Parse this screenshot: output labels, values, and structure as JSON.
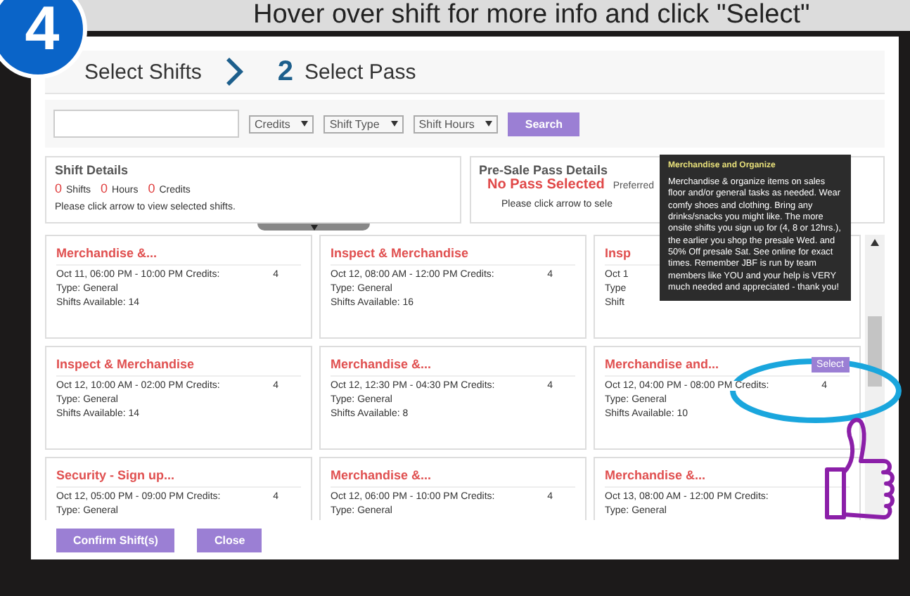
{
  "instruction": {
    "step": "4",
    "text": "Hover over shift for more info and click \"Select\""
  },
  "steps": [
    {
      "label": "Select Shifts"
    },
    {
      "number": "2",
      "label": "Select Pass"
    }
  ],
  "filters": {
    "dropdowns": [
      "Credits",
      "Shift Type",
      "Shift Hours"
    ],
    "search_button": "Search"
  },
  "shift_details": {
    "title": "Shift Details",
    "counts": [
      {
        "value": "0",
        "unit": "Shifts"
      },
      {
        "value": "0",
        "unit": "Hours"
      },
      {
        "value": "0",
        "unit": "Credits"
      }
    ],
    "hint": "Please click arrow to view selected shifts."
  },
  "pass_details": {
    "title": "Pre-Sale Pass Details",
    "status": "No Pass Selected",
    "preferred": "Preferred",
    "hint": "Please click arrow to sele"
  },
  "shifts": [
    {
      "title": "Merchandise &...",
      "time": "Oct 11, 06:00 PM - 10:00 PM Credits:",
      "credits": "4",
      "type": "Type: General",
      "available": "Shifts Available: 14",
      "hovered": false
    },
    {
      "title": "Inspect & Merchandise",
      "time": "Oct 12, 08:00 AM - 12:00 PM Credits:",
      "credits": "4",
      "type": "Type: General",
      "available": "Shifts Available: 16",
      "hovered": false
    },
    {
      "title": "Insp",
      "time": "Oct 1",
      "type": "Type",
      "available": "Shift",
      "hovered": false
    },
    {
      "title": "Inspect & Merchandise",
      "time": "Oct 12, 10:00 AM - 02:00 PM Credits:",
      "credits": "4",
      "type": "Type: General",
      "available": "Shifts Available: 14",
      "hovered": false
    },
    {
      "title": "Merchandise &...",
      "time": "Oct 12, 12:30 PM - 04:30 PM Credits:",
      "credits": "4",
      "type": "Type: General",
      "available": "Shifts Available: 8",
      "hovered": false
    },
    {
      "title": "Merchandise and...",
      "time": "Oct 12, 04:00 PM - 08:00 PM Credits:",
      "credits": "4",
      "type": "Type: General",
      "available": "Shifts Available: 10",
      "hovered": true,
      "select_label": "Select"
    },
    {
      "title": "Security - Sign up...",
      "time": "Oct 12, 05:00 PM - 09:00 PM Credits:",
      "credits": "4",
      "type": "Type: General",
      "hovered": false
    },
    {
      "title": "Merchandise &...",
      "time": "Oct 12, 06:00 PM - 10:00 PM Credits:",
      "credits": "4",
      "type": "Type: General",
      "hovered": false
    },
    {
      "title": "Merchandise &...",
      "time": "Oct 13, 08:00 AM - 12:00 PM Credits:",
      "type": "Type: General",
      "hovered": false
    }
  ],
  "tooltip": {
    "title": "Merchandise and Organize",
    "text": "Merchandise & organize items on sales floor and/or general tasks as needed. Wear comfy shoes and clothing. Bring any drinks/snacks you might like. The more onsite shifts you sign up for (4, 8 or 12hrs.), the earlier you shop the presale Wed. and 50% Off presale Sat. See online for exact times. Remember JBF is run by team members like YOU and your help is VERY much needed and appreciated - thank you!"
  },
  "buttons": [
    "Confirm Shift(s)",
    "Close"
  ]
}
